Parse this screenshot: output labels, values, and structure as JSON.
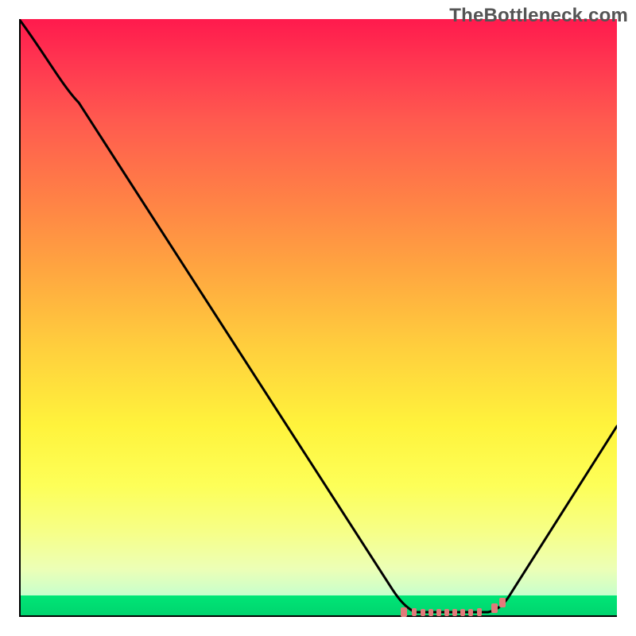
{
  "watermark": "TheBottleneck.com",
  "chart_data": {
    "type": "line",
    "title": "",
    "xlabel": "",
    "ylabel": "",
    "x": [
      0.0,
      0.05,
      0.1,
      0.15,
      0.2,
      0.25,
      0.3,
      0.35,
      0.4,
      0.45,
      0.5,
      0.55,
      0.6,
      0.625,
      0.65,
      0.7,
      0.75,
      0.78,
      0.8,
      0.85,
      0.9,
      0.95,
      1.0
    ],
    "values": [
      1.0,
      0.935,
      0.86,
      0.78,
      0.7,
      0.615,
      0.53,
      0.445,
      0.36,
      0.275,
      0.195,
      0.115,
      0.045,
      0.018,
      0.004,
      0.0,
      0.0,
      0.002,
      0.01,
      0.06,
      0.135,
      0.225,
      0.32
    ],
    "flat_region_x": [
      0.64,
      0.79
    ],
    "marker_color": "#e27a7a",
    "line_color": "#000000",
    "xlim": [
      0,
      1
    ],
    "ylim": [
      0,
      1
    ],
    "gradient_stops": [
      {
        "pos": 0.0,
        "color": "#ff1a4d"
      },
      {
        "pos": 0.3,
        "color": "#ff8146"
      },
      {
        "pos": 0.55,
        "color": "#ffcf3d"
      },
      {
        "pos": 0.78,
        "color": "#fdff58"
      },
      {
        "pos": 0.965,
        "color": "#c7ffcd"
      },
      {
        "pos": 0.965,
        "color": "#00e676"
      },
      {
        "pos": 1.0,
        "color": "#00d36e"
      }
    ]
  }
}
